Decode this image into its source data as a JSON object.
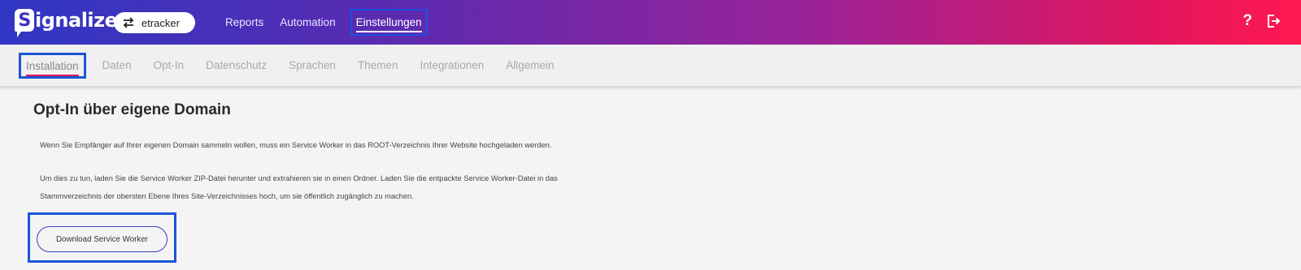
{
  "header": {
    "logo_text": "ignalize",
    "logo_letter": "S",
    "account": "etracker",
    "nav": [
      "Reports",
      "Automation",
      "Einstellungen"
    ],
    "help_glyph": "?",
    "gradient_start": "#2f37c4",
    "gradient_end": "#ff1950"
  },
  "subnav": {
    "tabs": [
      "Installation",
      "Daten",
      "Opt-In",
      "Datenschutz",
      "Sprachen",
      "Themen",
      "Integrationen",
      "Allgemein"
    ],
    "active": "Installation",
    "accent": "#e0165f"
  },
  "main": {
    "title": "Opt-In über eigene Domain",
    "paragraph1": "Wenn Sie Empfänger auf Ihrer eigenen Domain sammeln wollen, muss ein Service Worker in das ROOT-Verzeichnis Ihrer Website hochgeladen werden.",
    "paragraph2_line1": "Um dies zu tun, laden Sie die Service Worker ZIP-Datei herunter und extrahieren sie in einen Ordner. Laden Sie die entpackte Service Worker-Datei in das",
    "paragraph2_line2": "Stammverzeichnis der obersten Ebene Ihres Site-Verzeichnisses hoch, um sie öffentlich zugänglich zu machen.",
    "download_button": "Download Service Worker"
  },
  "icons": {
    "swap": "swap-arrows-icon",
    "help": "help-icon",
    "logout": "logout-icon"
  }
}
